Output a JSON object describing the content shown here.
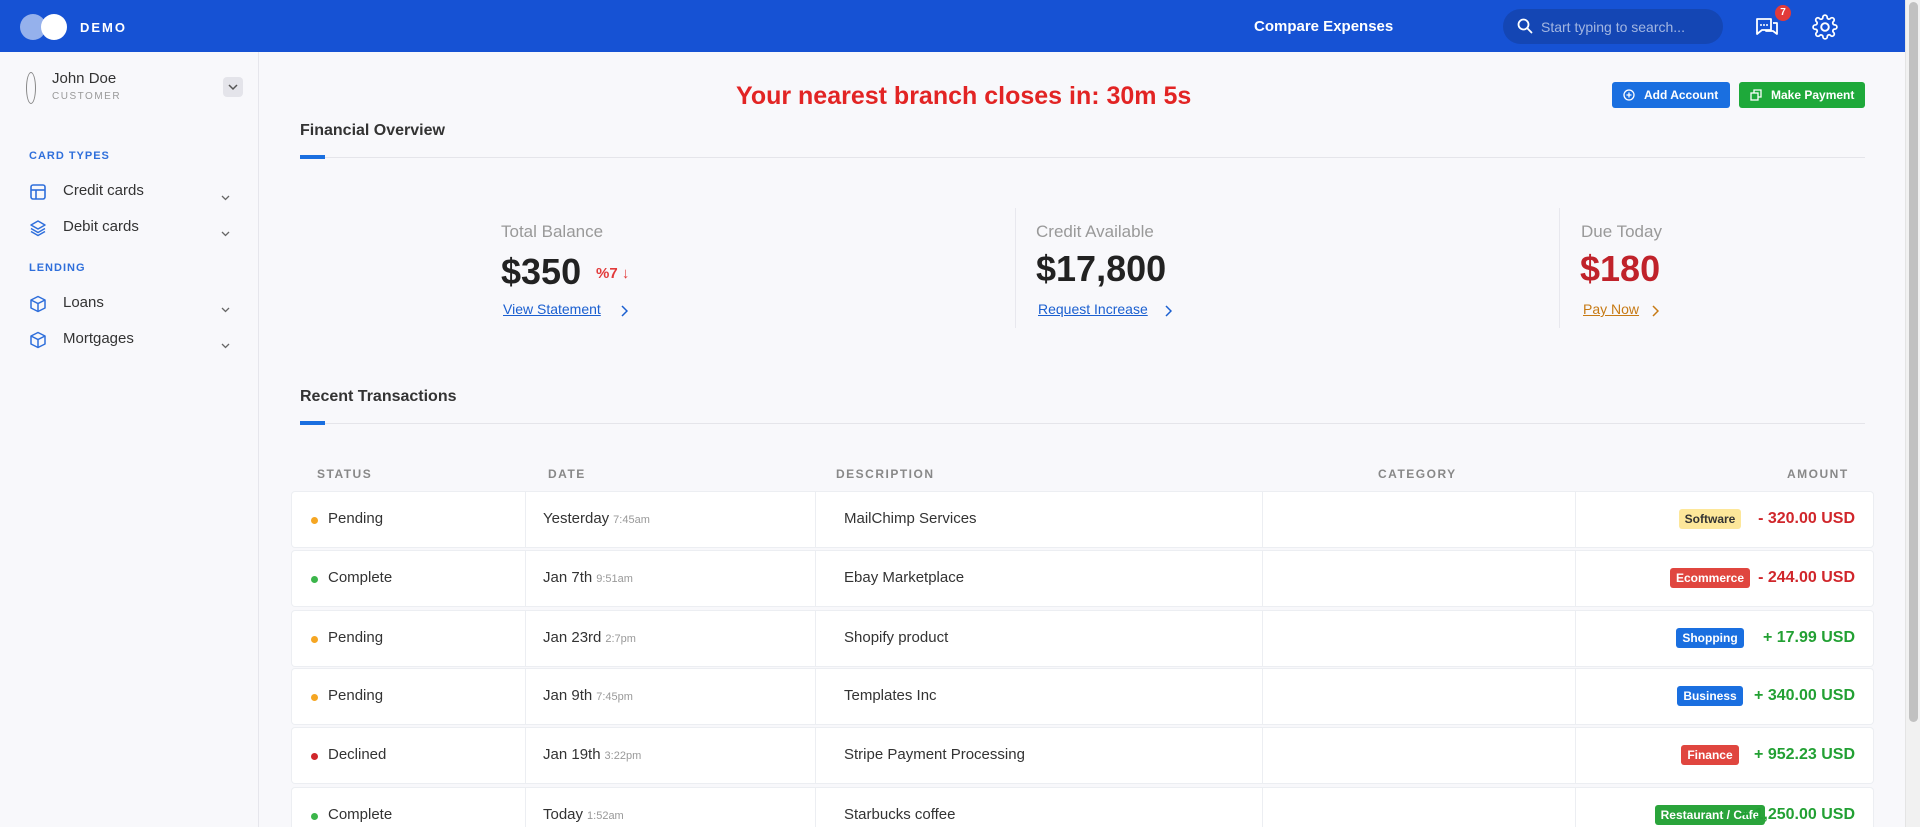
{
  "topbar": {
    "brand": "DEMO",
    "compare_label": "Compare Expenses",
    "search_placeholder": "Start typing to search...",
    "notif_count": "7"
  },
  "sidebar": {
    "user_name": "John Doe",
    "user_role": "CUSTOMER",
    "sections": [
      {
        "title": "CARD TYPES",
        "items": [
          {
            "label": "Credit cards",
            "icon": "credit-card-icon"
          },
          {
            "label": "Debit cards",
            "icon": "layers-icon"
          }
        ]
      },
      {
        "title": "LENDING",
        "items": [
          {
            "label": "Loans",
            "icon": "box-icon"
          },
          {
            "label": "Mortgages",
            "icon": "box-icon"
          }
        ]
      }
    ]
  },
  "main": {
    "countdown": "Your nearest branch closes in: 30m 5s",
    "add_account_label": "Add Account",
    "make_payment_label": "Make Payment",
    "overview_title": "Financial Overview",
    "stats": [
      {
        "label": "Total Balance",
        "value": "$350",
        "delta": "%7",
        "link": "View Statement"
      },
      {
        "label": "Credit Available",
        "value": "$17,800",
        "link": "Request Increase"
      },
      {
        "label": "Due Today",
        "value": "$180",
        "link": "Pay Now"
      }
    ],
    "transactions_title": "Recent Transactions",
    "table_headers": [
      "STATUS",
      "DATE",
      "DESCRIPTION",
      "CATEGORY",
      "AMOUNT"
    ],
    "rows": [
      {
        "status": "Pending",
        "date": "Yesterday",
        "time": "7:45am",
        "description": "MailChimp Services",
        "category": "Software",
        "amount": "- 320.00 USD"
      },
      {
        "status": "Complete",
        "date": "Jan 7th",
        "time": "9:51am",
        "description": "Ebay Marketplace",
        "category": "Ecommerce",
        "amount": "- 244.00 USD"
      },
      {
        "status": "Pending",
        "date": "Jan 23rd",
        "time": "2:7pm",
        "description": "Shopify product",
        "category": "Shopping",
        "amount": "+ 17.99 USD"
      },
      {
        "status": "Pending",
        "date": "Jan 9th",
        "time": "7:45pm",
        "description": "Templates Inc",
        "category": "Business",
        "amount": "+ 340.00 USD"
      },
      {
        "status": "Declined",
        "date": "Jan 19th",
        "time": "3:22pm",
        "description": "Stripe Payment Processing",
        "category": "Finance",
        "amount": "+ 952.23 USD"
      },
      {
        "status": "Complete",
        "date": "Today",
        "time": "1:52am",
        "description": "Starbucks coffee",
        "category": "Restaurant / Cafe",
        "amount": "+ 1,250.00 USD"
      }
    ]
  },
  "colors": {
    "topbar": "#1652d4",
    "accent_blue": "#1a6fe0",
    "green": "#1ea93a",
    "red": "#e23a3a",
    "pending": "#f5a623",
    "complete": "#3bb54a",
    "declined": "#d0262b",
    "software_bg": "#fde79a",
    "ecommerce_bg": "#e0463f",
    "shopping_bg": "#1a6fe0",
    "business_bg": "#1a6fe0",
    "finance_bg": "#e0463f",
    "cafe_bg": "#2aa43b",
    "amount_negative": "#d0262b",
    "amount_positive": "#22a033",
    "due_red": "#c0222a",
    "pay_now": "#c77a14"
  }
}
